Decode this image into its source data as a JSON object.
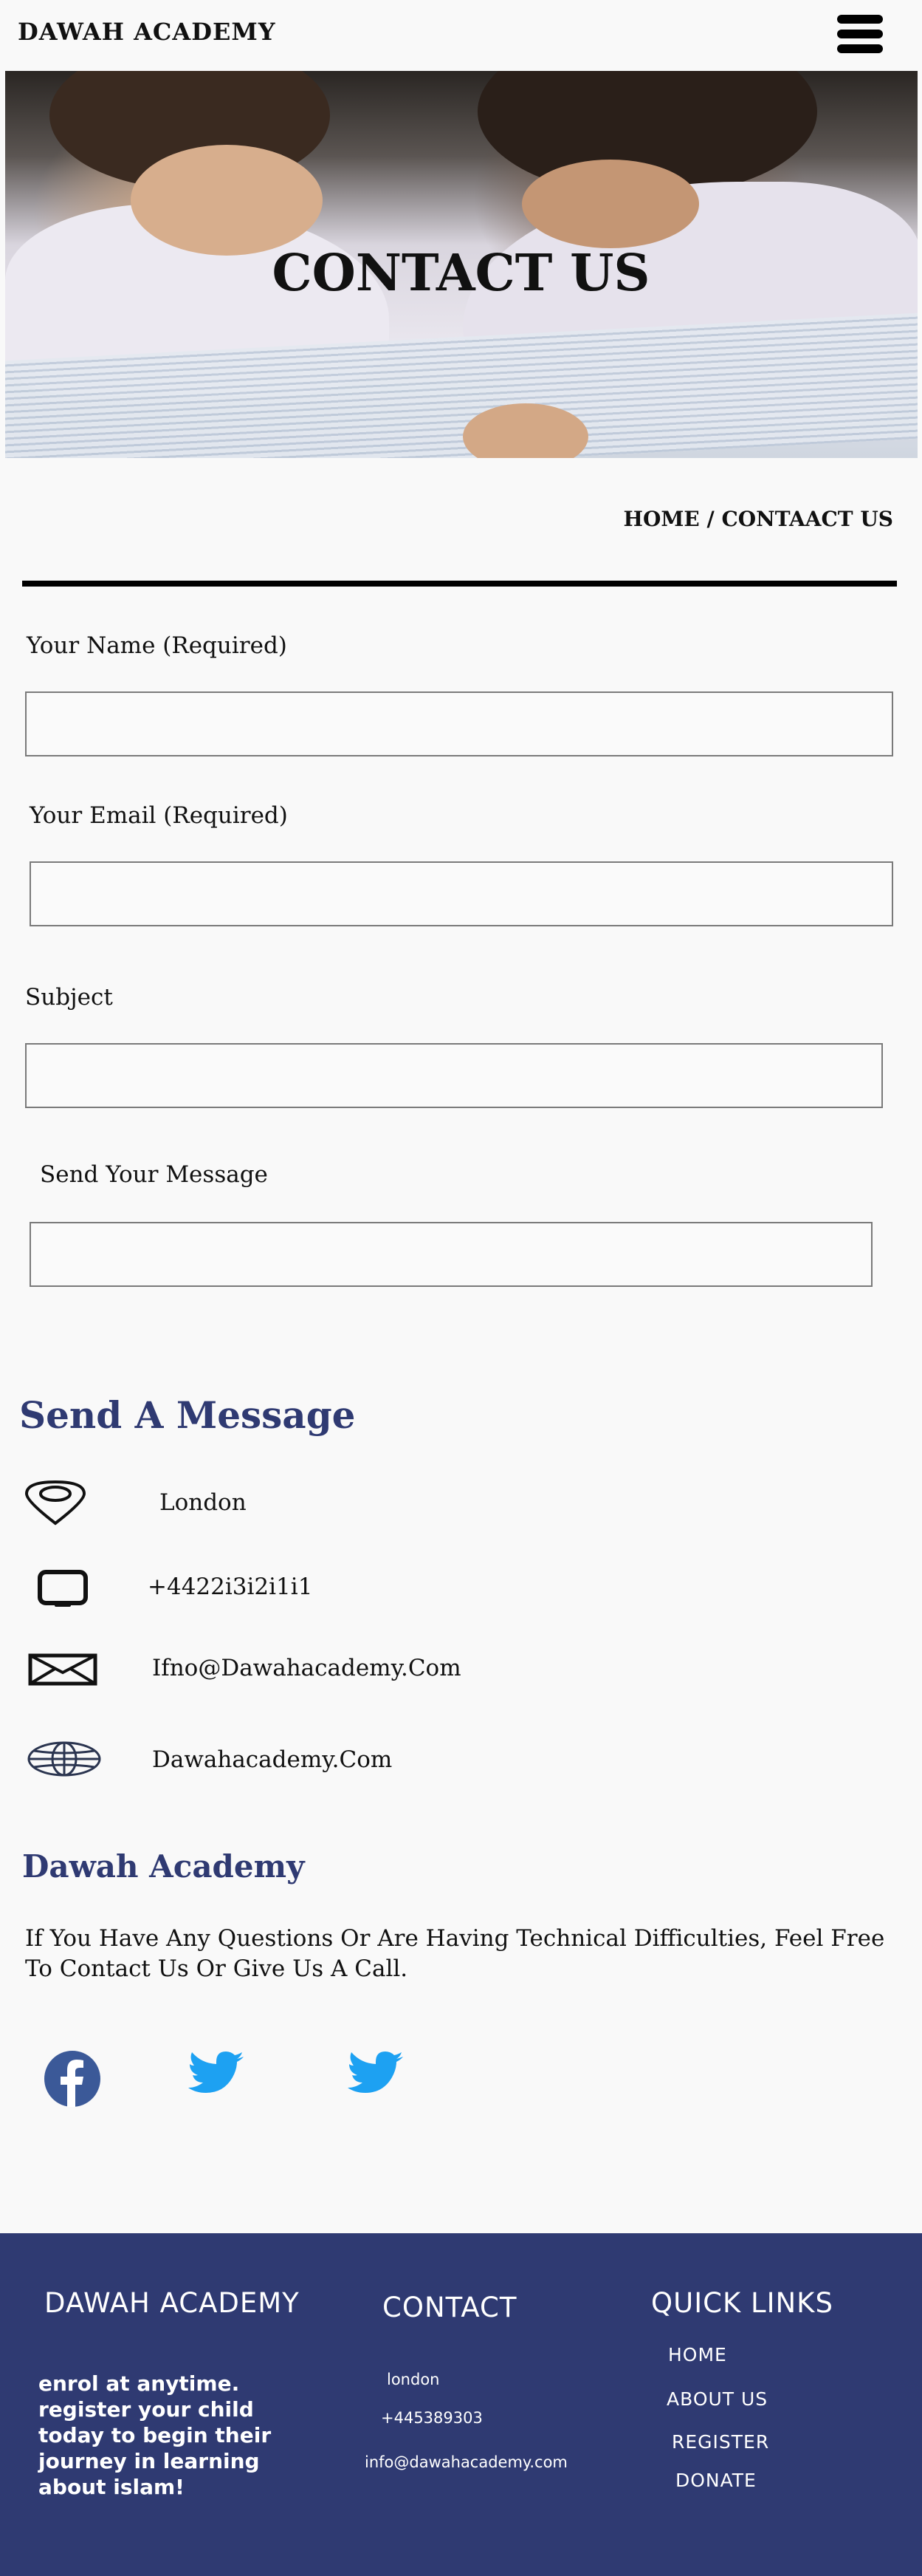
{
  "header": {
    "logo": "DAWAH ACADEMY"
  },
  "hero": {
    "title": "CONTACT US"
  },
  "breadcrumb": {
    "home": "HOME",
    "separator": " / ",
    "current": "CONTAACT US"
  },
  "form": {
    "name_label": "Your Name (Required)",
    "name_value": "",
    "email_label": "Your Email (Required)",
    "email_value": "",
    "subject_label": "Subject",
    "subject_value": "",
    "message_label": "Send Your Message",
    "message_value": ""
  },
  "contact_info": {
    "title": "Send A Message",
    "items": [
      {
        "icon": "location-icon",
        "text": "London"
      },
      {
        "icon": "tablet-icon",
        "text": "+4422i3i2i1i1"
      },
      {
        "icon": "envelope-icon",
        "text": "Ifno@Dawahacademy.Com"
      },
      {
        "icon": "globe-icon",
        "text": "Dawahacademy.Com"
      }
    ]
  },
  "about": {
    "title": "Dawah Academy",
    "text": "If You Have Any Questions Or Are Having Technical Difficulties, Feel Free To Contact Us Or Give Us A Call."
  },
  "social": [
    {
      "icon": "facebook-icon",
      "color": "#3b5998"
    },
    {
      "icon": "twitter-icon",
      "color": "#1da1f2"
    },
    {
      "icon": "twitter-icon",
      "color": "#1da1f2"
    }
  ],
  "footer": {
    "background": "#2f3a72",
    "col1_heading": "DAWAH ACADEMY",
    "col1_text": "enrol at anytime. register your child today to begin their journey in learning about islam!",
    "col2_heading": "CONTACT",
    "city": "london",
    "phone": "+445389303",
    "email": "info@dawahacademy.com",
    "col3_heading": "QUICK LINKS",
    "links": [
      "HOME",
      "ABOUT US",
      "REGISTER",
      "DONATE"
    ]
  }
}
